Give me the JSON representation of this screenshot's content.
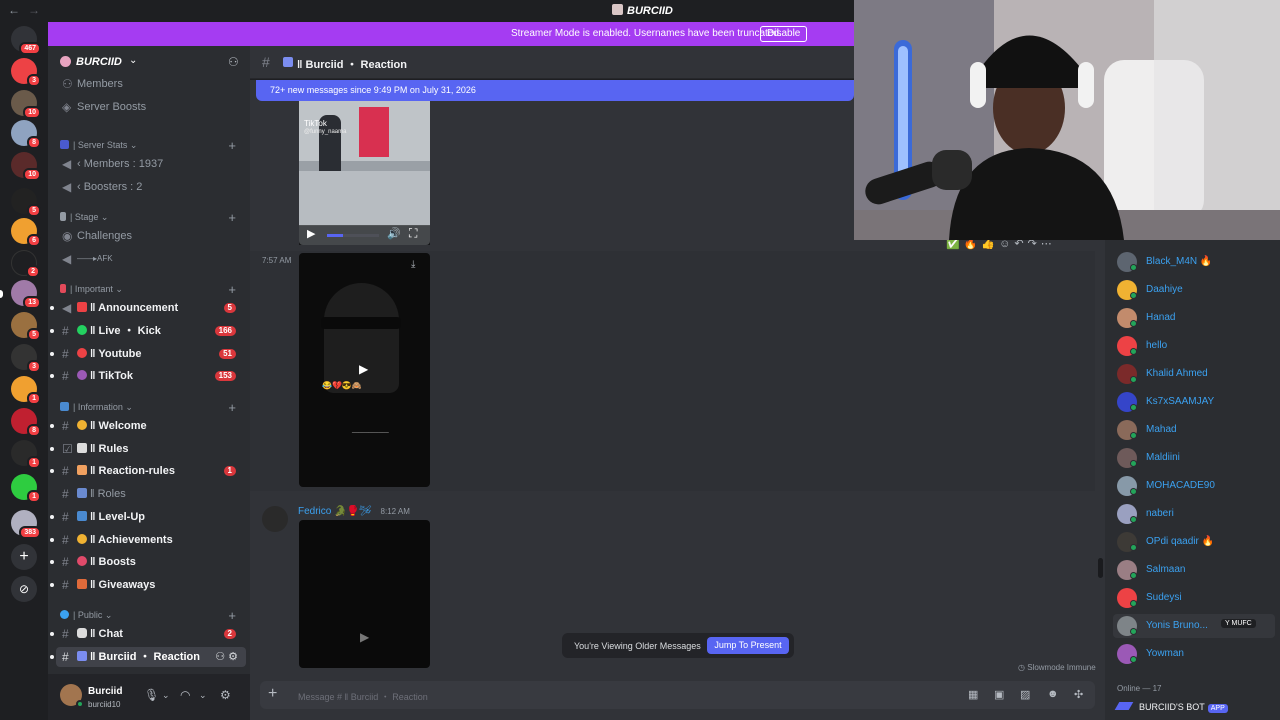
{
  "window": {
    "title": "BURCIID"
  },
  "streamer_banner": {
    "message": "Streamer Mode is enabled. Usernames have been truncated.",
    "action": "Disable"
  },
  "rail": {
    "badges": [
      "467",
      "3",
      "10",
      "8",
      "10",
      "5",
      "6",
      "2",
      "13",
      "5",
      "3",
      "1",
      "8",
      "1",
      "1",
      "383"
    ]
  },
  "server": {
    "name": "BURCIID"
  },
  "sidebar": {
    "top_items": [
      "Members",
      "Server Boosts"
    ],
    "categories": [
      {
        "name": "| Server Stats",
        "channels": [
          {
            "label": "‹ Members : 1937"
          },
          {
            "label": "‹ Boosters : 2"
          }
        ]
      },
      {
        "name": "| Stage",
        "channels": [
          {
            "label": "Challenges"
          },
          {
            "label": "——▸AFK"
          }
        ]
      },
      {
        "name": "| Important",
        "channels": [
          {
            "label": "‖ Announcement",
            "count": "5"
          },
          {
            "label": "‖ Live ・ Kick",
            "count": "166"
          },
          {
            "label": "‖ Youtube",
            "count": "51"
          },
          {
            "label": "‖ TikTok",
            "count": "153"
          }
        ]
      },
      {
        "name": "| Information",
        "channels": [
          {
            "label": "‖ Welcome"
          },
          {
            "label": "‖ Rules"
          },
          {
            "label": "‖ Reaction-rules",
            "count": "1"
          },
          {
            "label": "‖ Roles"
          },
          {
            "label": "‖ Level-Up"
          },
          {
            "label": "‖ Achievements"
          },
          {
            "label": "‖ Boosts"
          },
          {
            "label": "‖ Giveaways"
          }
        ]
      },
      {
        "name": "| Public",
        "channels": [
          {
            "label": "‖ Chat",
            "count": "2"
          },
          {
            "label": "‖ Burciid ・ Reaction"
          }
        ]
      }
    ]
  },
  "user": {
    "name": "Burciid",
    "tag": "burciid10"
  },
  "chat": {
    "channel": "‖ Burciid ・ Reaction",
    "new_messages": "72+ new messages since 9:49 PM on July 31, 2026",
    "video1_watermark": "TikTok",
    "video1_handle": "@funny_naama",
    "video1_progress": 0.3,
    "msg2_time": "7:57 AM",
    "video2_caption": "😂💔😎🙈",
    "video2_subtext": "___________",
    "msg3_author": "Fedrico",
    "msg3_author_emojis": "🐊🥊🛩",
    "msg3_time": "8:12 AM",
    "viewing": "You're Viewing Older Messages",
    "jump": "Jump To Present",
    "slowmode": "Slowmode Immune",
    "placeholder": "Message # ‖ Burciid ・ Reaction"
  },
  "members": {
    "list": [
      {
        "name": "Black_M4N 🔥",
        "color": "#5d6570"
      },
      {
        "name": "Daahiye",
        "color": "#f0b232"
      },
      {
        "name": "Hanad",
        "color": "#c28b6c"
      },
      {
        "name": "hello",
        "color": "#ed4245"
      },
      {
        "name": "Khalid Ahmed",
        "color": "#7b2a2a"
      },
      {
        "name": "Ks7xSAAMJAY",
        "color": "#3545c9"
      },
      {
        "name": "Mahad",
        "color": "#8a6a5a"
      },
      {
        "name": "Maldiini",
        "color": "#6e5a5a"
      },
      {
        "name": "MOHACADE90",
        "color": "#8799a8"
      },
      {
        "name": "naberi",
        "color": "#9aa0c0"
      },
      {
        "name": "OPdi qaadir 🔥",
        "color": "#3d3a36"
      },
      {
        "name": "Salmaan",
        "color": "#9a7e84"
      },
      {
        "name": "Sudeysi",
        "color": "#ed4245"
      },
      {
        "name": "Yonis Bruno...",
        "color": "#7e8488",
        "tag": "Y MUFC"
      },
      {
        "name": "Yowman",
        "color": "#9b59b6"
      }
    ],
    "online_header": "Online — 17",
    "bot_name": "BURCIID'S BOT",
    "bot_tag": "APP"
  }
}
